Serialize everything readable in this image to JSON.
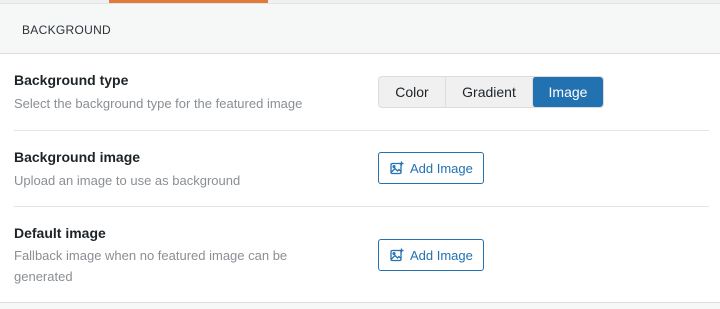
{
  "section": {
    "title": "BACKGROUND"
  },
  "colors": {
    "accent": "#2271b1",
    "tab_accent": "#e07b39"
  },
  "settings": [
    {
      "label": "Background type",
      "description": "Select the background type for the featured image",
      "control": {
        "type": "segmented",
        "options": [
          "Color",
          "Gradient",
          "Image"
        ],
        "selected": "Image"
      }
    },
    {
      "label": "Background image",
      "description": "Upload an image to use as background",
      "control": {
        "type": "button",
        "label": "Add Image",
        "icon": "add-image-icon"
      }
    },
    {
      "label": "Default image",
      "description": "Fallback image when no featured image can be generated",
      "control": {
        "type": "button",
        "label": "Add Image",
        "icon": "add-image-icon"
      }
    }
  ]
}
